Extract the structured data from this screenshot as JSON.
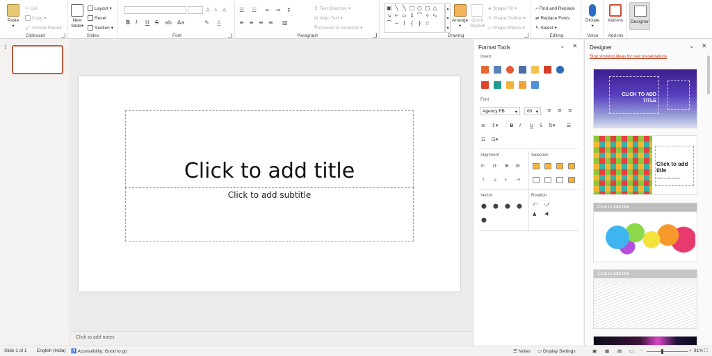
{
  "ribbon": {
    "clipboard": {
      "paste": "Paste",
      "cut": "Cut",
      "copy": "Copy",
      "format_painter": "Format Painter",
      "label": "Clipboard"
    },
    "slides": {
      "new_slide": "New",
      "new_slide_2": "Slide",
      "layout": "Layout",
      "reset": "Reset",
      "section": "Section",
      "label": "Slides"
    },
    "font": {
      "label": "Font",
      "bold": "B",
      "italic": "I",
      "underline": "U",
      "strike": "S",
      "grow": "A",
      "shrink": "A",
      "clear": "A"
    },
    "paragraph": {
      "label": "Paragraph",
      "text_direction": "Text Direction",
      "align_text": "Align Text",
      "convert": "Convert to SmartArt"
    },
    "drawing": {
      "label": "Drawing",
      "arrange": "Arrange",
      "quick_styles": "Quick",
      "quick_styles_2": "Styles",
      "shape_fill": "Shape Fill",
      "shape_outline": "Shape Outline",
      "shape_effects": "Shape Effects"
    },
    "editing": {
      "label": "Editing",
      "find_replace": "Find and Replace",
      "replace_fonts": "Replace Fonts",
      "select": "Select"
    },
    "voice": {
      "dictate": "Dictate",
      "label": "Voice"
    },
    "addins": {
      "addins": "Add-ins",
      "label": "Add-ins"
    },
    "designer": {
      "designer": "Designer"
    }
  },
  "thumbs": {
    "slide_number": "1"
  },
  "slide": {
    "title": "Click to add title",
    "subtitle": "Click to add subtitle"
  },
  "notes": {
    "placeholder": "Click to add notes"
  },
  "format_tools": {
    "title": "Format Tools",
    "insert_label": "Insert",
    "font_label": "Font",
    "font_name": "Agency FB",
    "font_size": "60",
    "alignment_label": "Alignment",
    "selection_label": "Selection",
    "vector_label": "Vector",
    "rotation_label": "Rotation"
  },
  "designer_pane": {
    "title": "Designer",
    "stop_link": "Stop showing ideas for new presentations",
    "card1_title": "CLICK TO ADD",
    "card1_title_2": "TITLE",
    "card2_title": "Click to add",
    "card2_title_2": "title",
    "card2_sub": "Click to add subtitle",
    "card3_title": "Click to add title",
    "card4_title": "Click to add title"
  },
  "status": {
    "slide": "Slide 1 of 1",
    "language": "English (India)",
    "accessibility": "Accessibility: Good to go",
    "notes": "Notes",
    "display_settings": "Display Settings",
    "zoom": "81%",
    "minus": "−",
    "plus": "+"
  },
  "colors": {
    "accent": "#c43e1c",
    "thumb_border": "#c55a3a"
  }
}
